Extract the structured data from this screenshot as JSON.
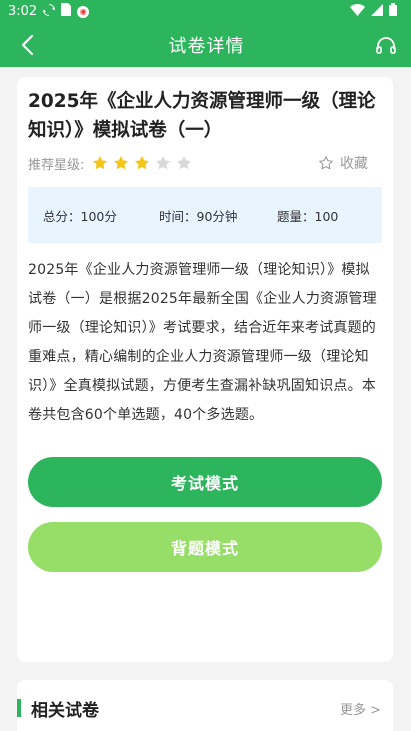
{
  "status_bar": {
    "time": "3:02"
  },
  "nav": {
    "title": "试卷详情"
  },
  "exam": {
    "title": "2025年《企业人力资源管理师一级（理论知识）》模拟试卷（一）",
    "rating_label": "推荐星级:",
    "rating": 3,
    "rating_max": 5,
    "favorite_label": "收藏",
    "total_score": "总分：100分",
    "time": "时间：90分钟",
    "question_count": "题量：100",
    "description": "2025年《企业人力资源管理师一级（理论知识）》模拟试卷（一）是根据2025年最新全国《企业人力资源管理师一级（理论知识）》考试要求，结合近年来考试真题的重难点，精心编制的企业人力资源管理师一级（理论知识）》全真模拟试题，方便考生查漏补缺巩固知识点。本卷共包含60个单选题，40个多选题。"
  },
  "buttons": {
    "exam_mode": "考试模式",
    "practice_mode": "背题模式"
  },
  "related": {
    "title": "相关试卷",
    "more": "更多 >"
  },
  "colors": {
    "primary": "#2db55d",
    "light_green": "#96de67",
    "star_active": "#f5c518",
    "star_inactive": "#d9d9d9",
    "info_bg": "#e8f4ff"
  }
}
